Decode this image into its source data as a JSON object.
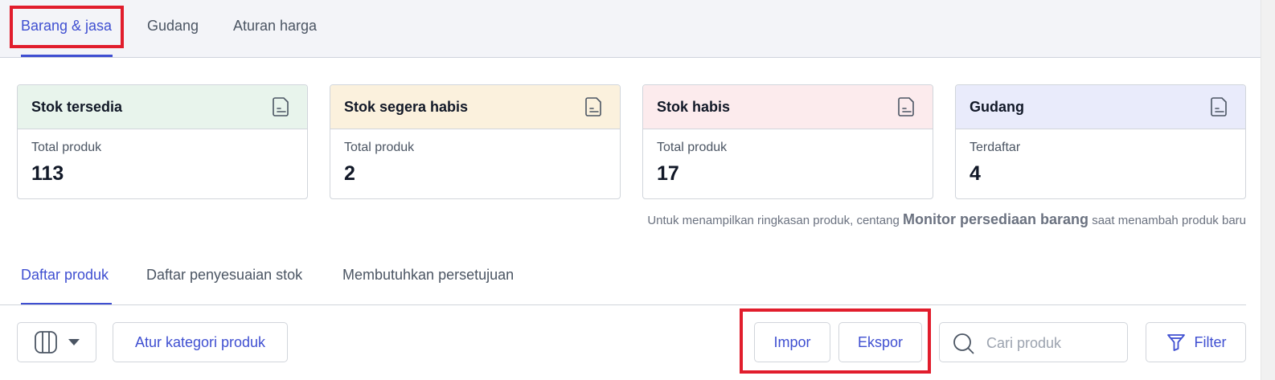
{
  "top_tabs": [
    {
      "label": "Barang & jasa",
      "active": true
    },
    {
      "label": "Gudang",
      "active": false
    },
    {
      "label": "Aturan harga",
      "active": false
    }
  ],
  "cards": [
    {
      "title": "Stok tersedia",
      "label": "Total produk",
      "value": "113",
      "color": "#e8f4ec",
      "icon": "report-icon"
    },
    {
      "title": "Stok segera habis",
      "label": "Total produk",
      "value": "2",
      "color": "#fbf1dd",
      "icon": "report-icon"
    },
    {
      "title": "Stok habis",
      "label": "Total produk",
      "value": "17",
      "color": "#fcebed",
      "icon": "report-icon"
    },
    {
      "title": "Gudang",
      "label": "Terdaftar",
      "value": "4",
      "color": "#e9ebfb",
      "icon": "report-icon"
    }
  ],
  "hint": {
    "before": "Untuk menampilkan ringkasan produk, centang ",
    "bold": "Monitor persediaan barang",
    "after": " saat menambah produk baru"
  },
  "sub_tabs": [
    {
      "label": "Daftar produk",
      "active": true
    },
    {
      "label": "Daftar penyesuaian stok",
      "active": false
    },
    {
      "label": "Membutuhkan persetujuan",
      "active": false
    }
  ],
  "toolbar": {
    "column_icon": "columns-icon",
    "category_button": "Atur kategori produk",
    "import_button": "Impor",
    "export_button": "Ekspor",
    "search_placeholder": "Cari produk",
    "filter_button": "Filter"
  },
  "colors": {
    "accent": "#3f4fd1",
    "highlight": "#e11d2c"
  }
}
